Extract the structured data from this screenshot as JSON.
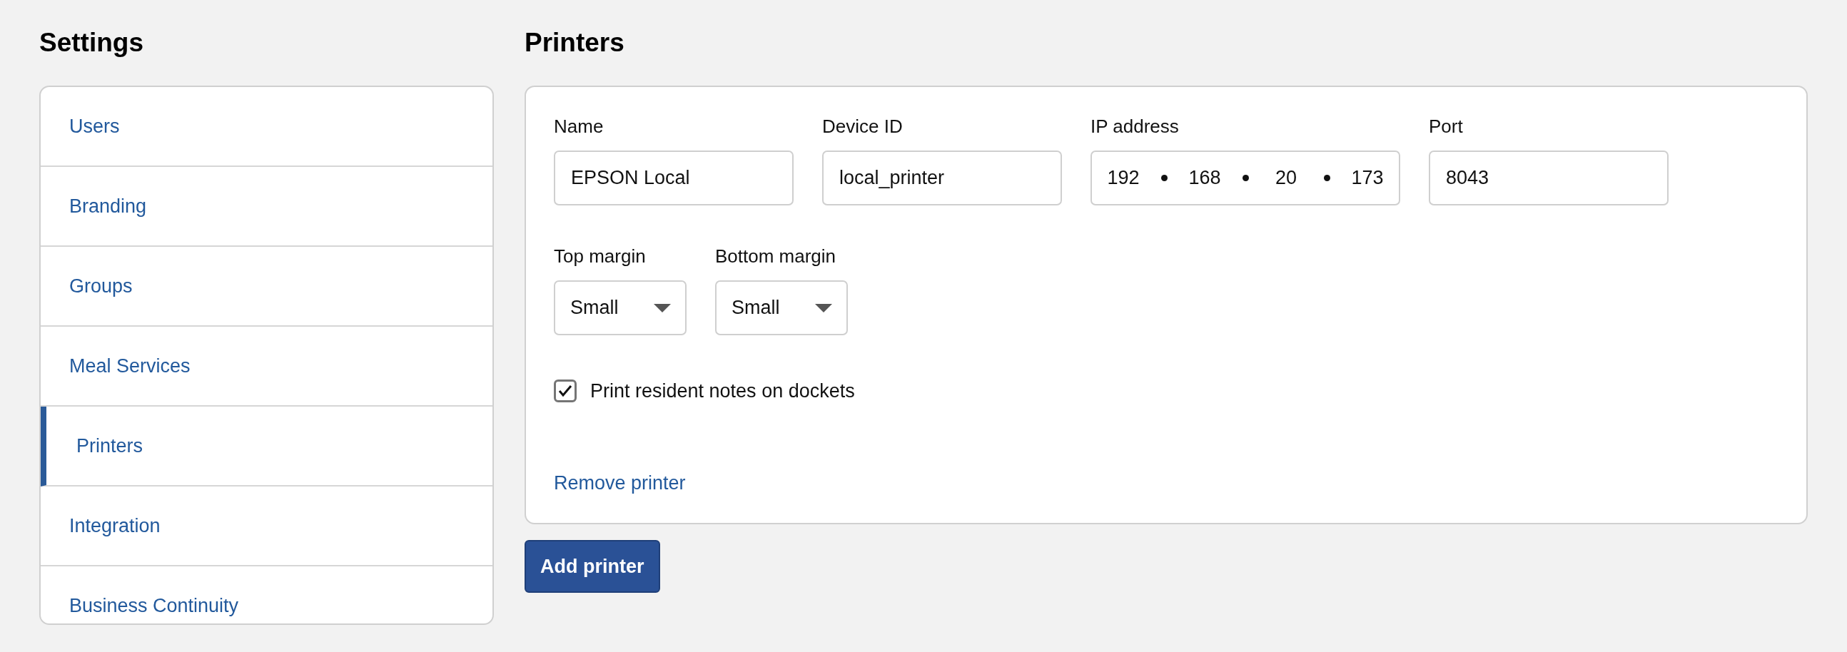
{
  "sidebar": {
    "title": "Settings",
    "items": [
      {
        "label": "Users",
        "selected": false
      },
      {
        "label": "Branding",
        "selected": false
      },
      {
        "label": "Groups",
        "selected": false
      },
      {
        "label": "Meal Services",
        "selected": false
      },
      {
        "label": "Printers",
        "selected": true
      },
      {
        "label": "Integration",
        "selected": false
      },
      {
        "label": "Business Continuity",
        "selected": false
      }
    ]
  },
  "main": {
    "title": "Printers",
    "printer": {
      "fields": [
        {
          "kind": "text",
          "label": "Name",
          "value": "EPSON Local"
        },
        {
          "kind": "text",
          "label": "Device ID",
          "value": "local_printer"
        },
        {
          "kind": "ip",
          "label": "IP address",
          "octets": [
            "192",
            "168",
            "20",
            "173"
          ]
        },
        {
          "kind": "text",
          "label": "Port",
          "value": "8043"
        }
      ],
      "selects": [
        {
          "label": "Top margin",
          "value": "Small"
        },
        {
          "label": "Bottom margin",
          "value": "Small"
        }
      ],
      "checkbox": {
        "label": "Print resident notes on dockets",
        "checked": true
      },
      "remove_link": "Remove printer"
    },
    "add_button": "Add printer"
  }
}
